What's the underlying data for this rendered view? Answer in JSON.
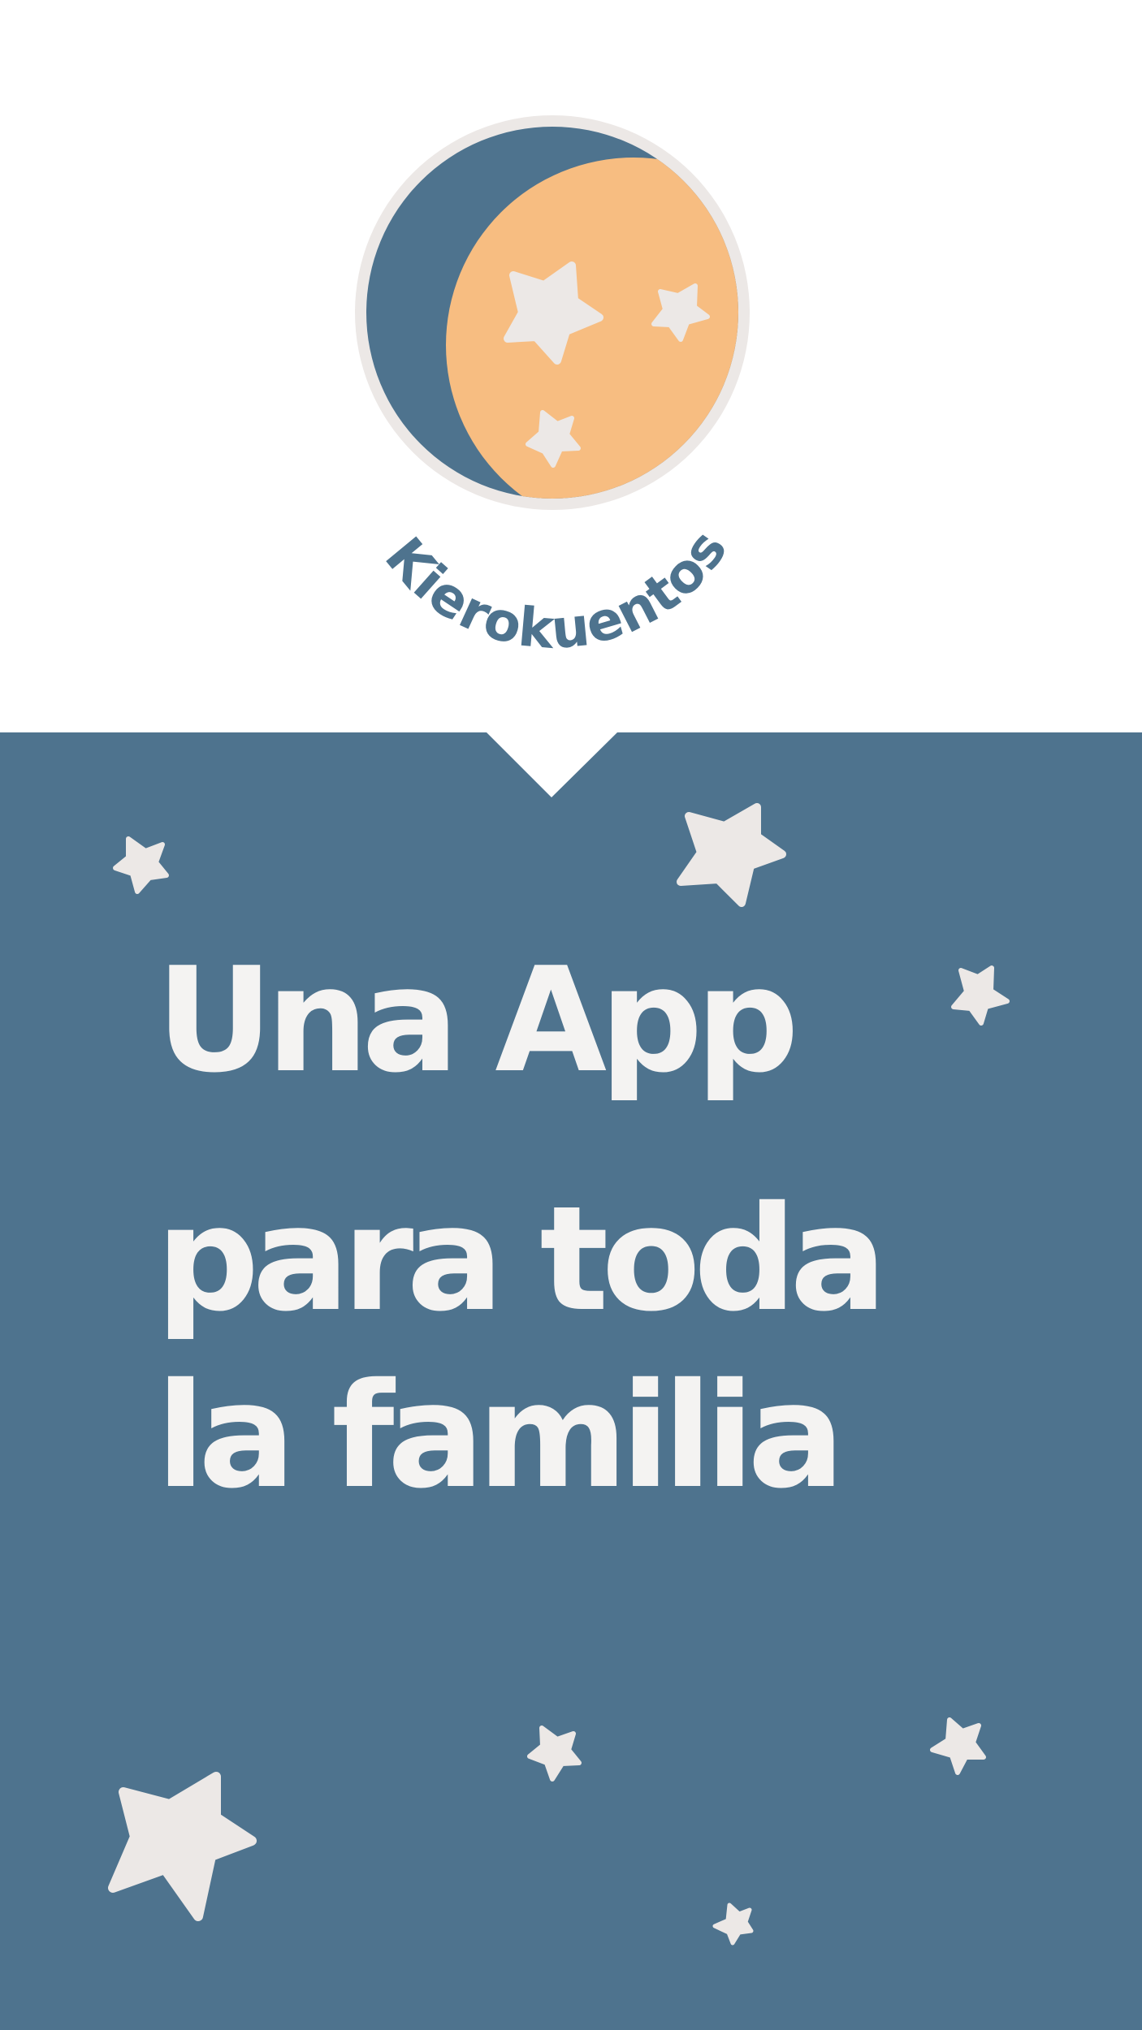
{
  "brand": {
    "name": "Kierokuentos",
    "logo_icon": "moon-with-stars-icon"
  },
  "hero": {
    "headline_lines": [
      "Una App",
      "para toda",
      "la familia"
    ]
  },
  "colors": {
    "background": "#ffffff",
    "panel": "#4e738e",
    "moon_dark": "#4e738e",
    "moon_light": "#f7bd81",
    "ring": "#ece8e6",
    "star": "#ece8e6",
    "headline_text": "#f4f3f2"
  }
}
